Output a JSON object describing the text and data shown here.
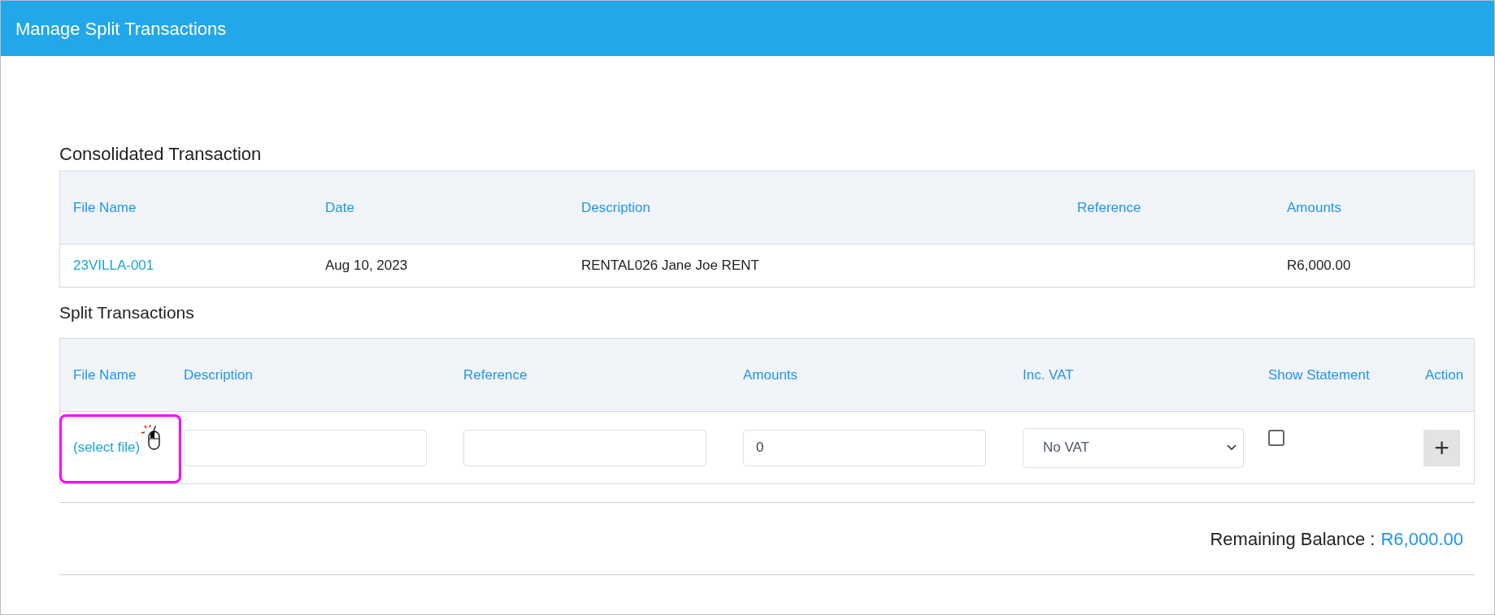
{
  "window": {
    "title": "Manage Split Transactions"
  },
  "consolidated": {
    "heading": "Consolidated Transaction",
    "columns": [
      "File Name",
      "Date",
      "Description",
      "Reference",
      "Amounts"
    ],
    "rows": [
      {
        "file_name": "23VILLA-001",
        "date": "Aug 10, 2023",
        "description": "RENTAL026 Jane Joe RENT",
        "amount": "R6,000.00"
      }
    ]
  },
  "split": {
    "heading": "Split Transactions",
    "columns": [
      "File Name",
      "Description",
      "Reference",
      "Amounts",
      "Inc. VAT",
      "Show Statement",
      "Action"
    ],
    "rows": [
      {
        "file_link": "(select file)",
        "amount_value": "0",
        "vat": "No VAT",
        "show_statement": false,
        "action": "+",
        "highlighted": true
      }
    ]
  },
  "remaining_balance": {
    "label": "Remaining Balance :",
    "value": "R6,000.00"
  }
}
